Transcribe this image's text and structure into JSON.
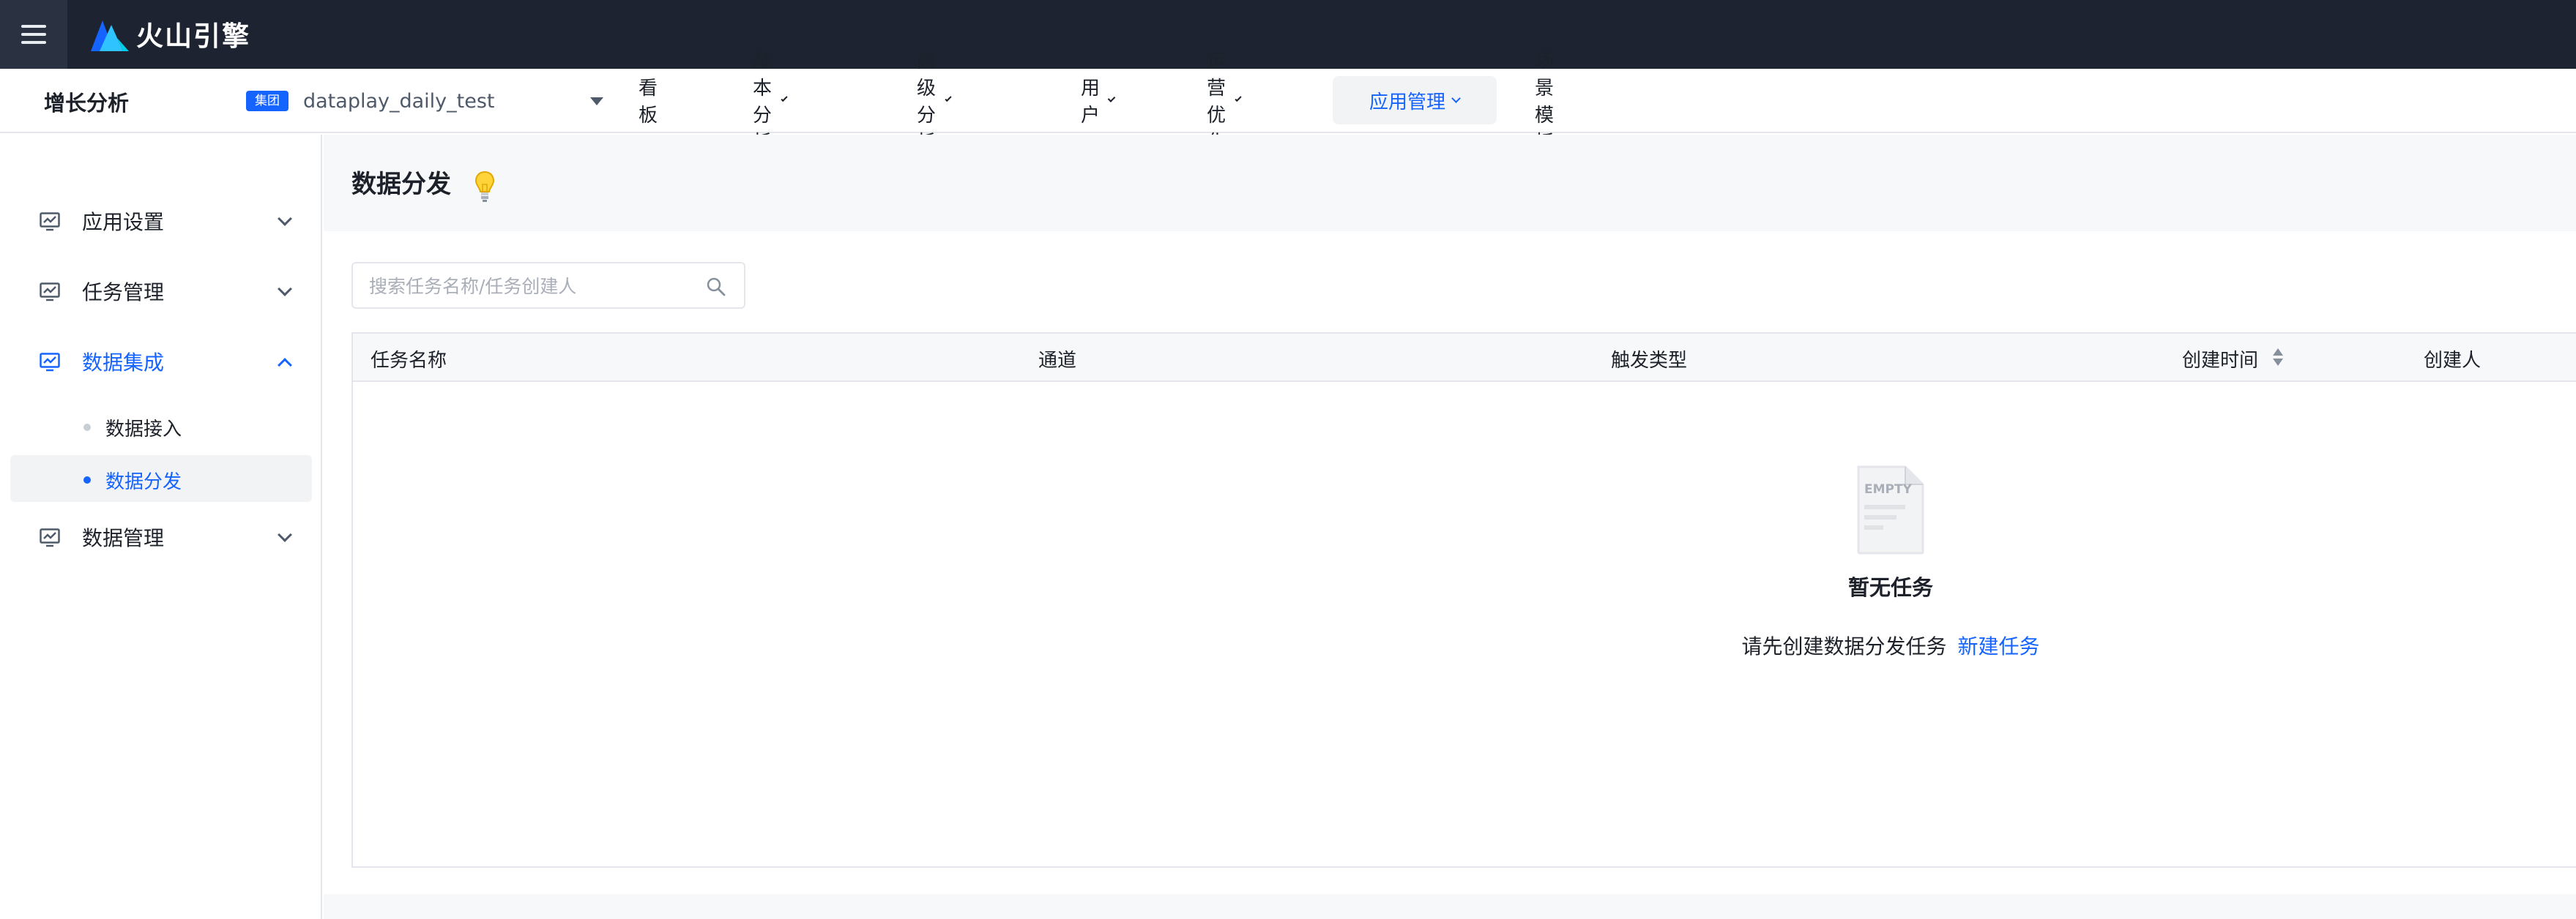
{
  "brand": {
    "logo_text": "火山引擎",
    "logo_colors": [
      "#1664ff",
      "#2fc3ff",
      "#ffffff"
    ]
  },
  "navbar": {
    "product_name": "增长分析",
    "app_selector": {
      "tag": "集团",
      "value": "dataplay_daily_test"
    },
    "items": [
      {
        "label": "看板",
        "has_dropdown": false,
        "active": false
      },
      {
        "label": "基本分析",
        "has_dropdown": true,
        "active": false
      },
      {
        "label": "高级分析",
        "has_dropdown": true,
        "active": false
      },
      {
        "label": "用户",
        "has_dropdown": true,
        "active": false
      },
      {
        "label": "运营优化",
        "has_dropdown": true,
        "active": false
      },
      {
        "label": "应用管理",
        "has_dropdown": true,
        "active": true
      },
      {
        "label": "场景模板",
        "has_dropdown": false,
        "active": false
      }
    ]
  },
  "sidebar": {
    "groups": [
      {
        "label": "应用设置",
        "icon": "monitor-chart-icon",
        "expanded": false
      },
      {
        "label": "任务管理",
        "icon": "monitor-chart-icon",
        "expanded": false
      },
      {
        "label": "数据集成",
        "icon": "monitor-chart-icon",
        "expanded": true,
        "children": [
          {
            "label": "数据接入",
            "active": false
          },
          {
            "label": "数据分发",
            "active": true
          }
        ]
      },
      {
        "label": "数据管理",
        "icon": "monitor-chart-icon",
        "expanded": false
      }
    ]
  },
  "page": {
    "title": "数据分发",
    "help_icon": "lightbulb-icon",
    "search": {
      "placeholder": "搜索任务名称/任务创建人",
      "value": ""
    },
    "table": {
      "columns": [
        "任务名称",
        "通道",
        "触发类型",
        "创建时间",
        "创建人"
      ],
      "sortable_column": "创建时间",
      "rows": []
    },
    "empty_state": {
      "icon_text": "EMPTY",
      "title": "暂无任务",
      "description": "请先创建数据分发任务",
      "action_label": "新建任务"
    }
  },
  "colors": {
    "topbar_bg": "#1d2331",
    "accent": "#1664ff",
    "page_bg": "#f7f8fa",
    "border": "#e5e6eb"
  }
}
